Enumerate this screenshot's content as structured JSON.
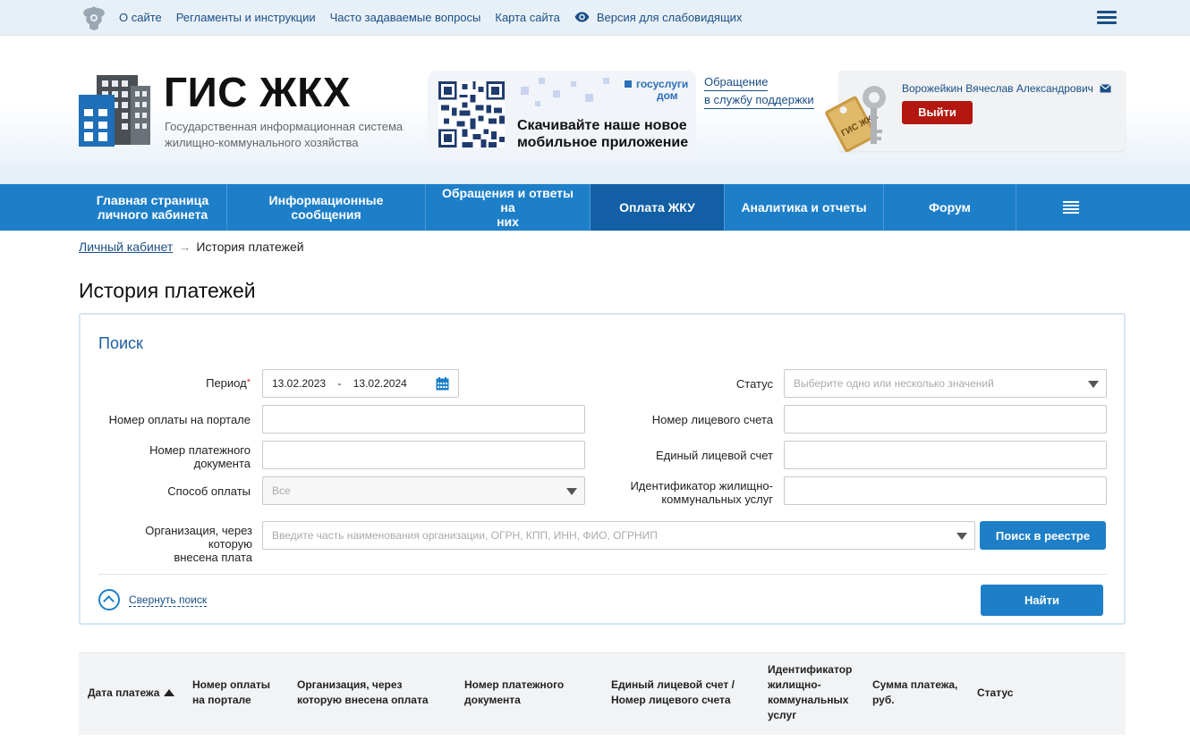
{
  "topbar": {
    "links": [
      "О сайте",
      "Регламенты и инструкции",
      "Часто задаваемые вопросы",
      "Карта сайта"
    ],
    "accessibility": "Версия для слабовидящих"
  },
  "header": {
    "title": "ГИС ЖКХ",
    "subtitle_line1": "Государственная информационная система",
    "subtitle_line2": "жилищно-коммунального хозяйства",
    "promo_brand_line1": "госуслуги",
    "promo_brand_line2": "дом",
    "promo_text_line1": "Скачивайте наше новое",
    "promo_text_line2": "мобильное приложение",
    "support_line1": "Обращение",
    "support_line2": "в службу поддержки",
    "user_name": "Ворожейкин Вячеслав Александрович",
    "logout_label": "Выйти",
    "keys_label": "ГИС ЖКХ"
  },
  "nav": {
    "items": [
      {
        "line1": "Главная страница",
        "line2": "личного кабинета"
      },
      {
        "line1": "Информационные сообщения",
        "line2": ""
      },
      {
        "line1": "Обращения и ответы на",
        "line2": "них"
      },
      {
        "line1": "Оплата ЖКУ",
        "line2": ""
      },
      {
        "line1": "Аналитика и отчеты",
        "line2": ""
      },
      {
        "line1": "Форум",
        "line2": ""
      }
    ]
  },
  "breadcrumb": {
    "parent": "Личный кабинет",
    "arrow": "→",
    "current": "История платежей"
  },
  "page_title": "История платежей",
  "search": {
    "title": "Поиск",
    "period_label": "Период",
    "period_required": "*",
    "period_from": "13.02.2023",
    "period_sep": "-",
    "period_to": "13.02.2024",
    "payment_number_label": "Номер оплаты на портале",
    "payment_doc_label_line1": "Номер платежного",
    "payment_doc_label_line2": "документа",
    "method_label": "Способ оплаты",
    "method_value": "Все",
    "org_label_line1": "Организация, через которую",
    "org_label_line2": "внесена плата",
    "org_placeholder": "Введите часть наименования организации, ОГРН, КПП, ИНН, ФИО, ОГРНИП",
    "registry_button": "Поиск в реестре",
    "status_label": "Статус",
    "status_placeholder": "Выберите одно или несколько значений",
    "account_label": "Номер лицевого счета",
    "single_account_label": "Единый лицевой счет",
    "service_id_label_line1": "Идентификатор жилищно-",
    "service_id_label_line2": "коммунальных услуг",
    "collapse_label": "Свернуть поиск",
    "find_button": "Найти"
  },
  "table": {
    "columns": [
      [
        "Дата платежа"
      ],
      [
        "Номер оплаты",
        "на портале"
      ],
      [
        "Организация, через",
        "которую внесена оплата"
      ],
      [
        "Номер платежного",
        "документа"
      ],
      [
        "Единый лицевой счет /",
        "Номер лицевого счета"
      ],
      [
        "Идентификатор",
        "жилищно-",
        "коммунальных",
        "услуг"
      ],
      [
        "Сумма платежа,",
        "руб."
      ],
      [
        "Статус"
      ]
    ]
  },
  "colors": {
    "nav_blue": "#1e7fc9",
    "nav_active": "#125fa5",
    "logout_red": "#b3170f",
    "link_blue": "#1a4f86"
  }
}
